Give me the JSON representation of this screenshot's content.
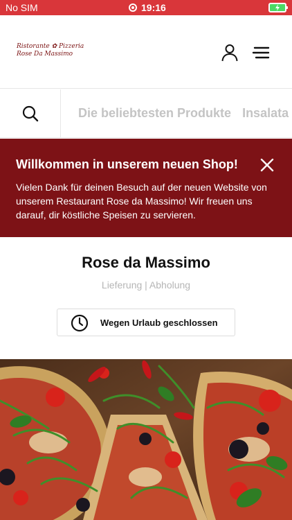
{
  "status_bar": {
    "carrier": "No SIM",
    "time": "19:16"
  },
  "header": {
    "logo_line1": "Ristorante ✿ Pizzeria",
    "logo_line2": "Rose Da Massimo"
  },
  "categories": {
    "items": [
      "Die beliebtesten Produkte",
      "Insalata"
    ]
  },
  "banner": {
    "title": "Willkommen in unserem neuen Shop!",
    "text": "Vielen Dank für deinen Besuch auf der neuen Website von unserem Restaurant Rose da Massimo! Wir freuen uns darauf, dir köstliche Speisen zu servieren."
  },
  "restaurant": {
    "name": "Rose da Massimo",
    "modes": "Lieferung | Abholung",
    "status_label": "Wegen Urlaub geschlossen"
  },
  "colors": {
    "status_bar": "#d9363a",
    "banner": "#7d1216",
    "category_text": "#c4c4c4"
  },
  "icons": [
    "user-icon",
    "menu-icon",
    "search-icon",
    "close-icon",
    "clock-icon"
  ]
}
